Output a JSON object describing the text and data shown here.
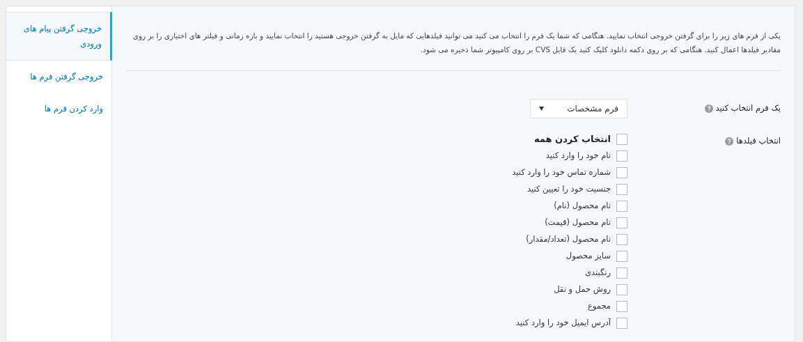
{
  "sidebar": {
    "items": [
      {
        "label": "خروجی گرفتن پیام های ورودی",
        "selected": true
      },
      {
        "label": "خروجی گرفتن فرم ها",
        "selected": false
      },
      {
        "label": "وارد کردن فرم ها",
        "selected": false
      }
    ]
  },
  "description": "یکی از فرم های زیر را برای گرفتن خروجی انتخاب نمایید. هنگامی که شما یک فرم را انتخاب می کنید می توانید فیلدهایی که مایل به گرفتن خروجی هستید را انتخاب نمایید و بازه زمانی و فیلتر های اختیاری را بر روی مقادیر فیلدها اعمال کنید. هنگامی که بر روی دکمه دانلود کلیک کنید یک فایل CVS بر روی کامپیوتر شما ذخیره می شود.",
  "form_select": {
    "label": "یک فرم انتخاب کنید",
    "value": "فرم مشخصات"
  },
  "fields": {
    "label": "انتخاب فیلدها",
    "options": [
      {
        "label": "انتخاب کردن همه",
        "checked": false,
        "kind": "all"
      },
      {
        "label": "نام خود را وارد کنید",
        "checked": false,
        "kind": "field"
      },
      {
        "label": "شماره تماس خود را وارد کنید",
        "checked": false,
        "kind": "field"
      },
      {
        "label": "جنسیت خود را تعیین کنید",
        "checked": false,
        "kind": "field"
      },
      {
        "label": "نام محصول (نام)",
        "checked": false,
        "kind": "field"
      },
      {
        "label": "نام محصول (قیمت)",
        "checked": false,
        "kind": "field"
      },
      {
        "label": "نام محصول (تعداد/مقدار)",
        "checked": false,
        "kind": "field"
      },
      {
        "label": "سایز محصول",
        "checked": false,
        "kind": "field"
      },
      {
        "label": "رنگبندی",
        "checked": false,
        "kind": "field"
      },
      {
        "label": "روش حمل و نقل",
        "checked": false,
        "kind": "field"
      },
      {
        "label": "مجموع",
        "checked": false,
        "kind": "field"
      },
      {
        "label": "آدرس ایمیل خود را وارد کنید",
        "checked": false,
        "kind": "field"
      }
    ]
  }
}
